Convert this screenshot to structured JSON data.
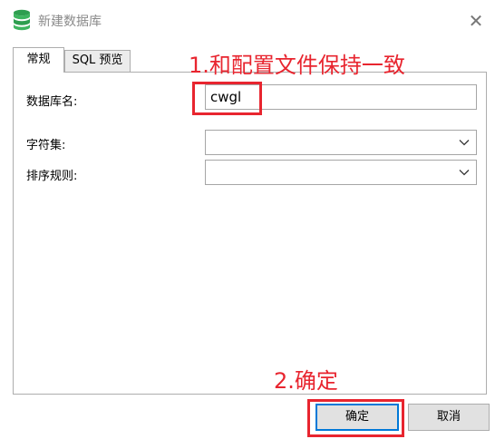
{
  "window": {
    "title": "新建数据库",
    "icon": "database-icon",
    "close_glyph": "✕"
  },
  "tabs": [
    {
      "label": "常规",
      "active": true
    },
    {
      "label": "SQL 预览",
      "active": false
    }
  ],
  "form": {
    "db_name_label": "数据库名:",
    "db_name_value": "cwgl",
    "charset_label": "字符集:",
    "charset_value": "",
    "collation_label": "排序规则:",
    "collation_value": ""
  },
  "annotations": {
    "step1": "1.和配置文件保持一致",
    "step2": "2.确定",
    "color": "#e8252f"
  },
  "buttons": {
    "ok": "确定",
    "cancel": "取消"
  },
  "colors": {
    "db_icon": "#2e9e4f",
    "accent_border": "#0078d7"
  }
}
